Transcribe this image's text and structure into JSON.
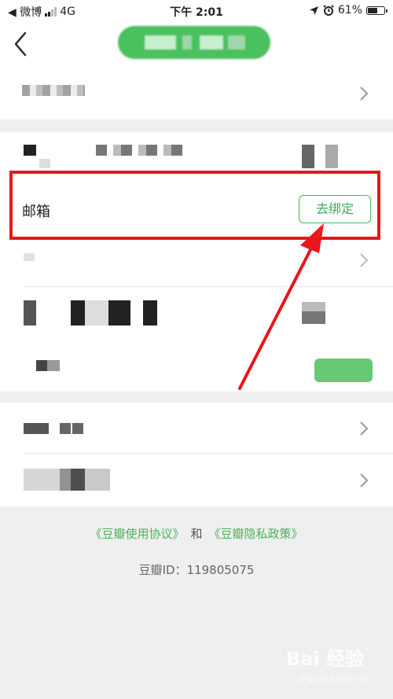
{
  "status_bar": {
    "back_app": "◀ 微博",
    "network": "4G",
    "time": "下午 2:01",
    "battery": "61%",
    "battery_level": 0.61
  },
  "email_row": {
    "label": "邮箱",
    "button": "去绑定"
  },
  "footer": {
    "agreement_link": "《豆瓣使用协议》",
    "and_text": "和",
    "privacy_link": "《豆瓣隐私政策》",
    "douban_id": "豆瓣ID：119805075"
  },
  "watermark": {
    "text": "Bai 经验",
    "sub": "jingyan.baidu.com"
  },
  "colors": {
    "accent_green": "#4ab35a",
    "annotation_red": "#e8161a",
    "toast_green": "#4ac05e"
  }
}
